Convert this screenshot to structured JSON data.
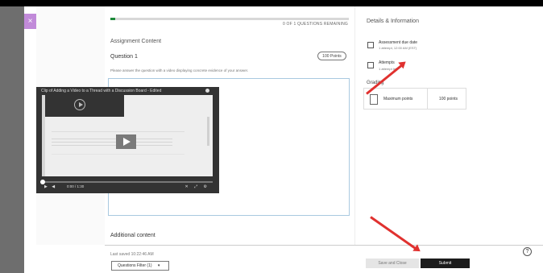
{
  "progress": {
    "text": "0 OF 1 QUESTIONS REMAINING",
    "value": 0.02
  },
  "assignment": {
    "section_title": "Assignment Content",
    "question_title": "Question 1",
    "points": "100 Points",
    "instructions": "Please answer the question with a video displaying concrete evidence of your answer."
  },
  "video": {
    "title": "Clip of Adding a Video to a Thread with a Discussion Board - Edited",
    "time": "0:00 / 1:30",
    "left_controls": "▶ ◀",
    "right_controls": "✕ ⤢ ⚙"
  },
  "additional_title": "Additional content",
  "details": {
    "title": "Details & Information",
    "due_label": "Assessment due date",
    "due_value": "1 attempt, 12:00 AM (EST)",
    "attempts_label": "Attempts",
    "attempts_value": "1 attempt left",
    "grading_label": "Grading",
    "max_points_label": "Maximum points",
    "max_points_value": "100 points"
  },
  "footer": {
    "last_saved": "Last saved 10:22:46 AM",
    "filter": "Questions Filter (1)",
    "save_close": "Save and Close",
    "submit": "Submit",
    "help": "?"
  },
  "ui": {
    "close": "×",
    "chevron": "▾"
  }
}
